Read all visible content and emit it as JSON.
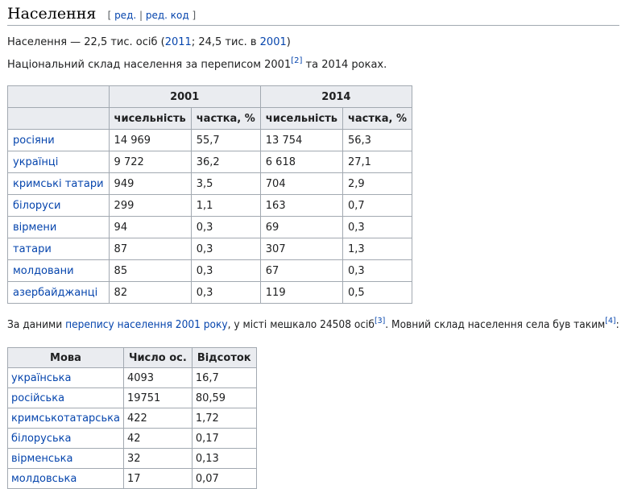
{
  "section": {
    "title": "Населення",
    "edit_open": "[ ",
    "edit_label": "ред.",
    "edit_sep": " | ",
    "edit_code_label": "ред. код",
    "edit_close": " ]"
  },
  "population_line": {
    "prefix": "Населення — 22,5 тис. осіб (",
    "year1": "2011",
    "mid": "; 24,5 тис. в ",
    "year2": "2001",
    "suffix": ")"
  },
  "national_line": {
    "text_before": "Національний склад населення за переписом 2001",
    "ref": "[2]",
    "text_after": " та 2014 роках."
  },
  "national_table": {
    "year_2001": "2001",
    "year_2014": "2014",
    "col_count": "чисельність",
    "col_share": "частка, %",
    "rows": [
      {
        "name": "росіяни",
        "c2001": "14 969",
        "s2001": "55,7",
        "c2014": "13 754",
        "s2014": "56,3"
      },
      {
        "name": "українці",
        "c2001": "9 722",
        "s2001": "36,2",
        "c2014": "6 618",
        "s2014": "27,1"
      },
      {
        "name": "кримські татари",
        "c2001": "949",
        "s2001": "3,5",
        "c2014": "704",
        "s2014": "2,9"
      },
      {
        "name": "білоруси",
        "c2001": "299",
        "s2001": "1,1",
        "c2014": "163",
        "s2014": "0,7"
      },
      {
        "name": "вірмени",
        "c2001": "94",
        "s2001": "0,3",
        "c2014": "69",
        "s2014": "0,3"
      },
      {
        "name": "татари",
        "c2001": "87",
        "s2001": "0,3",
        "c2014": "307",
        "s2014": "1,3"
      },
      {
        "name": "молдовани",
        "c2001": "85",
        "s2001": "0,3",
        "c2014": "67",
        "s2014": "0,3"
      },
      {
        "name": "азербайджанці",
        "c2001": "82",
        "s2001": "0,3",
        "c2014": "119",
        "s2014": "0,5"
      }
    ]
  },
  "census_line": {
    "prefix": "За даними ",
    "link": "перепису населення 2001 року",
    "middle": ", у місті мешкало 24508 осіб",
    "ref1": "[3]",
    "after": ". Мовний склад населення села був таким",
    "ref2": "[4]",
    "end": ":"
  },
  "language_table": {
    "col_lang": "Мова",
    "col_count": "Число ос.",
    "col_percent": "Відсоток",
    "rows": [
      {
        "lang": "українська",
        "count": "4093",
        "percent": "16,7"
      },
      {
        "lang": "російська",
        "count": "19751",
        "percent": "80,59"
      },
      {
        "lang": "кримськотатарська",
        "count": "422",
        "percent": "1,72"
      },
      {
        "lang": "білоруська",
        "count": "42",
        "percent": "0,17"
      },
      {
        "lang": "вірменська",
        "count": "32",
        "percent": "0,13"
      },
      {
        "lang": "молдовська",
        "count": "17",
        "percent": "0,07"
      }
    ]
  }
}
